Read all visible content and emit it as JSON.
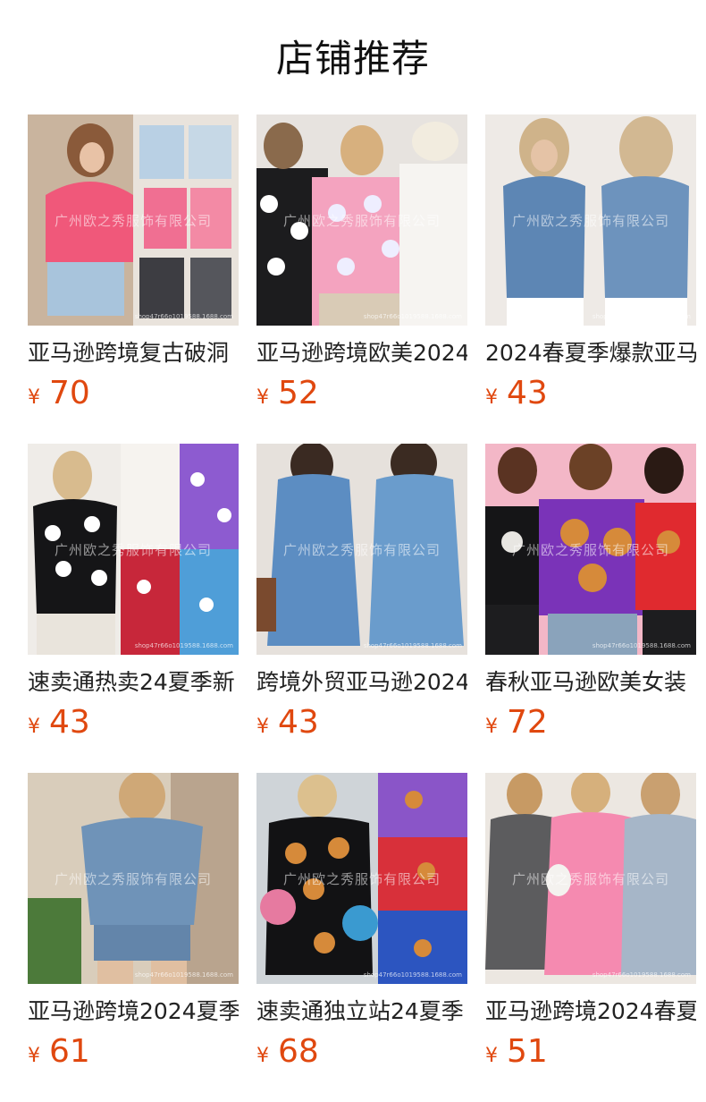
{
  "page": {
    "title": "店铺推荐"
  },
  "watermark": "广州欧之秀服饰有限公司",
  "shopmark": "shop47r66o1019588.1688.com",
  "currency": "¥",
  "products": [
    {
      "title": "亚马逊跨境复古破洞",
      "price": "70",
      "scene": "pink-denim-jacket"
    },
    {
      "title": "亚马逊跨境欧美2024",
      "price": "52",
      "scene": "baseball-sweatshirt"
    },
    {
      "title": "2024春夏季爆款亚马",
      "price": "43",
      "scene": "denim-shirt"
    },
    {
      "title": "速卖通热卖24夏季新",
      "price": "43",
      "scene": "baseball-tee"
    },
    {
      "title": "跨境外贸亚马逊2024",
      "price": "43",
      "scene": "denim-dress"
    },
    {
      "title": "春秋亚马逊欧美女装",
      "price": "72",
      "scene": "basketball-sweatshirt"
    },
    {
      "title": "亚马逊跨境2024夏季",
      "price": "61",
      "scene": "denim-romper"
    },
    {
      "title": "速卖通独立站24夏季",
      "price": "68",
      "scene": "basketball-dress"
    },
    {
      "title": "亚马逊跨境2024春夏",
      "price": "51",
      "scene": "shirt-dresses"
    }
  ]
}
